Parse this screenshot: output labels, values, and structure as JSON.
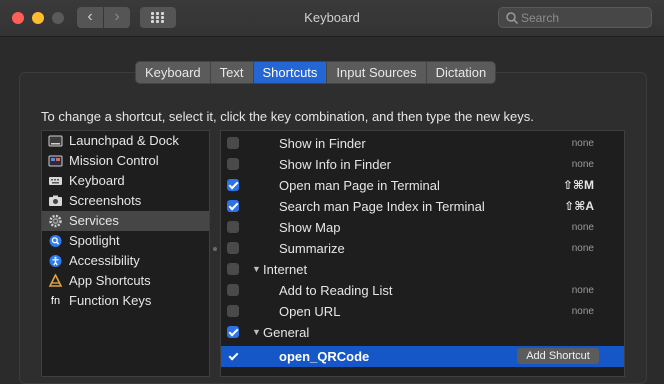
{
  "window": {
    "title": "Keyboard"
  },
  "toolbar": {
    "back_glyph": "‹",
    "forward_glyph": "›",
    "search_placeholder": "Search"
  },
  "tabs": [
    {
      "label": "Keyboard",
      "active": false
    },
    {
      "label": "Text",
      "active": false
    },
    {
      "label": "Shortcuts",
      "active": true
    },
    {
      "label": "Input Sources",
      "active": false
    },
    {
      "label": "Dictation",
      "active": false
    }
  ],
  "instructions": "To change a shortcut, select it, click the key combination, and then type the new keys.",
  "categories": [
    {
      "label": "Launchpad & Dock",
      "icon": "launchpad-dock-icon"
    },
    {
      "label": "Mission Control",
      "icon": "mission-control-icon"
    },
    {
      "label": "Keyboard",
      "icon": "keyboard-icon"
    },
    {
      "label": "Screenshots",
      "icon": "screenshots-icon"
    },
    {
      "label": "Services",
      "icon": "gear-icon",
      "selected": true
    },
    {
      "label": "Spotlight",
      "icon": "spotlight-search-icon"
    },
    {
      "label": "Accessibility",
      "icon": "accessibility-icon"
    },
    {
      "label": "App Shortcuts",
      "icon": "app-shortcuts-icon"
    },
    {
      "label": "Function Keys",
      "icon": "fn-key-icon",
      "glyph": "fn"
    }
  ],
  "services": [
    {
      "label": "Show in Finder",
      "checked": false,
      "shortcut": "none"
    },
    {
      "label": "Show Info in Finder",
      "checked": false,
      "shortcut": "none"
    },
    {
      "label": "Open man Page in Terminal",
      "checked": true,
      "shortcut": "⇧⌘M"
    },
    {
      "label": "Search man Page Index in Terminal",
      "checked": true,
      "shortcut": "⇧⌘A"
    },
    {
      "label": "Show Map",
      "checked": false,
      "shortcut": "none"
    },
    {
      "label": "Summarize",
      "checked": false,
      "shortcut": "none"
    },
    {
      "label": "Internet",
      "checked": false,
      "group": true
    },
    {
      "label": "Add to Reading List",
      "checked": false,
      "shortcut": "none"
    },
    {
      "label": "Open URL",
      "checked": false,
      "shortcut": "none"
    },
    {
      "label": "General",
      "checked": true,
      "group": true
    },
    {
      "label": "open_QRCode",
      "checked": true,
      "selected": true,
      "button": "Add Shortcut"
    }
  ],
  "colors": {
    "accent": "#2566d5",
    "selection": "#1557c6"
  }
}
